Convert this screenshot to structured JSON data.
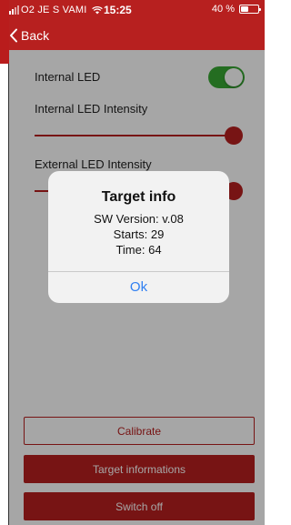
{
  "status_bar": {
    "carrier": "O2 JE S VAMI",
    "time": "15:25",
    "battery": "40 %"
  },
  "nav": {
    "back_label": "Back"
  },
  "settings": {
    "internal_led_label": "Internal LED",
    "internal_led_on": true,
    "internal_intensity_label": "Internal LED Intensity",
    "internal_intensity_fraction": 1.0,
    "external_intensity_label": "External LED Intensity",
    "external_intensity_fraction": 1.0
  },
  "dialog": {
    "title": "Target info",
    "sw_version": "SW Version: v.08",
    "starts": "Starts: 29",
    "time": "Time: 64",
    "ok_label": "Ok"
  },
  "buttons": {
    "calibrate": "Calibrate",
    "target_informations": "Target informations",
    "switch_off": "Switch off"
  },
  "colors": {
    "brand_red": "#b7201f",
    "toggle_green": "#38a833",
    "ok_blue": "#2f7ff2"
  }
}
